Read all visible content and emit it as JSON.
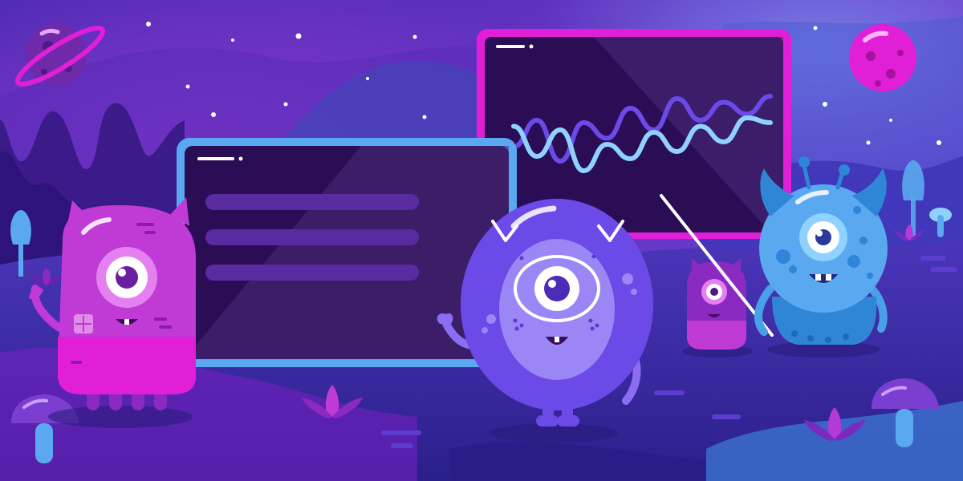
{
  "scene": {
    "palette": {
      "sky_top": "#3b2a9e",
      "sky_mid": "#6a35c7",
      "magenta": "#e11fd6",
      "violet": "#6b4ae8",
      "blue": "#5aa8ef",
      "cyan_light": "#8fd2ff",
      "ground": "#3d2aa4",
      "screen_dark": "#2b0d55",
      "planet": "#c03ad6"
    },
    "icons": [
      "ringed-planet-icon",
      "pink-planet-icon",
      "star-icon",
      "mushroom-icon",
      "lotus-flower-icon",
      "pointer-stick-icon"
    ],
    "line_chart": {
      "series_a": [
        0.62,
        0.4,
        0.74,
        0.42,
        0.55,
        0.3,
        0.48,
        0.22,
        0.4,
        0.25,
        0.35,
        0.2
      ],
      "series_b": [
        0.45,
        0.7,
        0.48,
        0.82,
        0.6,
        0.72,
        0.5,
        0.66,
        0.45,
        0.58,
        0.38,
        0.42
      ]
    }
  }
}
